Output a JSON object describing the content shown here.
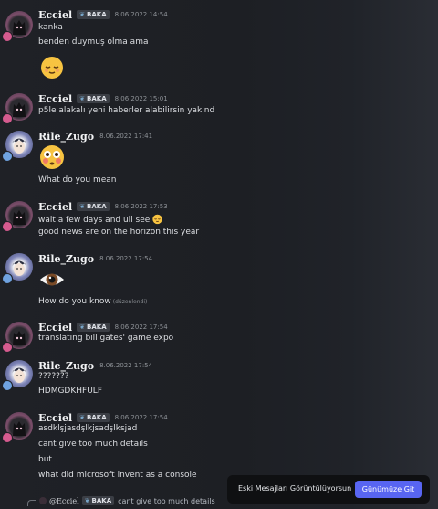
{
  "users": {
    "ecciel": {
      "name": "Ecciel",
      "tag": "BAKA"
    },
    "rile": {
      "name": "Rile_Zugo"
    }
  },
  "messages": [
    {
      "author": "Ecciel",
      "tag": "BAKA",
      "time": "8.06.2022 14:54",
      "lines": [
        "kanka",
        "benden duymuş olma ama"
      ],
      "emoji": "relieved-face-emoji"
    },
    {
      "author": "Ecciel",
      "tag": "BAKA",
      "time": "8.06.2022 15:01",
      "lines": [
        "p5le alakalı yeni haberler alabilirsin yakınd"
      ]
    },
    {
      "author": "Rile_Zugo",
      "time": "8.06.2022 17:41",
      "emoji": "flushed-face-emoji",
      "lines": [
        "What do you mean"
      ]
    },
    {
      "author": "Ecciel",
      "tag": "BAKA",
      "time": "8.06.2022 17:53",
      "lines": [
        "wait a few days and ull see",
        "good news are on the horizon this year"
      ],
      "inline_emoji": "relieved-face-emoji"
    },
    {
      "author": "Rile_Zugo",
      "time": "8.06.2022 17:54",
      "emoji": "eye-emoji",
      "lines": [
        "How do you know"
      ],
      "edited": "(düzenlendi)"
    },
    {
      "author": "Ecciel",
      "tag": "BAKA",
      "time": "8.06.2022 17:54",
      "lines": [
        "translating bill gates' game expo"
      ]
    },
    {
      "author": "Rile_Zugo",
      "time": "8.06.2022 17:54",
      "lines": [
        "???????",
        "HDMGDKHFULF"
      ]
    },
    {
      "author": "Ecciel",
      "tag": "BAKA",
      "time": "8.06.2022 17:54",
      "lines": [
        "asdklşjasdşlkjsadşlksjad",
        "cant give too much details",
        "but",
        "what did microsoft invent as a console"
      ]
    }
  ],
  "reply_preview": {
    "mention": "@Ecciel",
    "tag": "BAKA",
    "text": "cant give too much details"
  },
  "banner": {
    "text": "Eski Mesajları Görüntülüyorsun",
    "button": "Günümüze Git"
  },
  "colors": {
    "accent": "#5865f2",
    "background": "#1f2126"
  }
}
